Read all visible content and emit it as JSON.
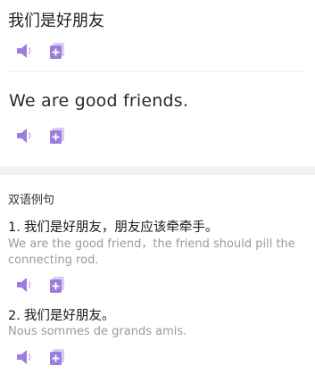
{
  "header": {
    "source_text": "我们是好朋友"
  },
  "translation": {
    "text": "We are good friends."
  },
  "examples": {
    "heading": "双语例句",
    "items": [
      {
        "number": "1.",
        "chinese": "我们是好朋友，朋友应该牵牵手。",
        "translation": "We are the good friend，the friend should pill the connecting rod."
      },
      {
        "number": "2.",
        "chinese": "我们是好朋友。",
        "translation": "Nous sommes de grands amis."
      }
    ]
  },
  "icons": {
    "speaker": "speaker-icon",
    "add_to_notebook": "add-to-notebook-icon"
  },
  "colors": {
    "accent_purple": "#9b7ddc",
    "accent_purple_light": "#d9ccf5",
    "text_primary": "#1f1f1f",
    "text_secondary": "#9a9a9a",
    "divider_band": "#f2f2f4"
  }
}
